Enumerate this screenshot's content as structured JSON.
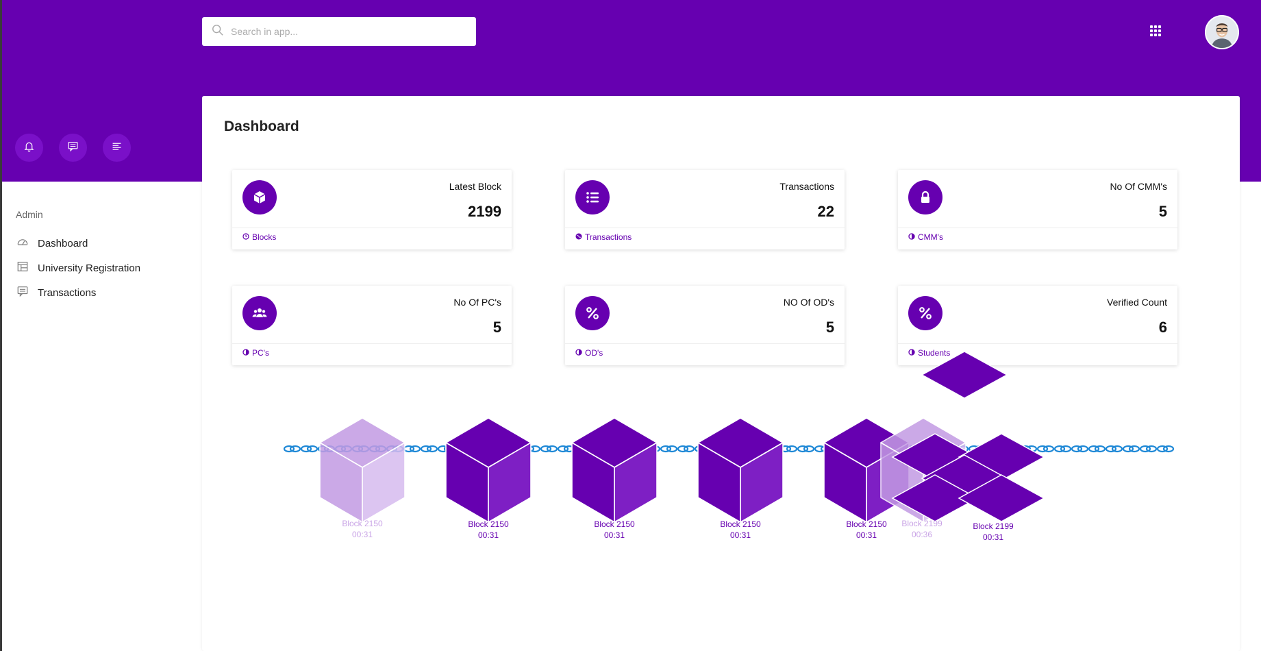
{
  "header": {
    "search_placeholder": "Search in app...",
    "apps_icon": "grid-icon",
    "avatar": "user-avatar"
  },
  "quick_actions": [
    {
      "icon": "bell-icon"
    },
    {
      "icon": "message-icon"
    },
    {
      "icon": "align-left-icon"
    }
  ],
  "sidebar": {
    "section_label": "Admin",
    "items": [
      {
        "label": "Dashboard",
        "icon": "dashboard-icon"
      },
      {
        "label": "University Registration",
        "icon": "table-icon"
      },
      {
        "label": "Transactions",
        "icon": "message-icon"
      }
    ]
  },
  "main": {
    "title": "Dashboard",
    "cards": [
      {
        "label": "Latest Block",
        "value": "2199",
        "footer": "Blocks",
        "icon": "cube-icon",
        "footer_icon": "clock-icon"
      },
      {
        "label": "Transactions",
        "value": "22",
        "footer": "Transactions",
        "icon": "list-icon",
        "footer_icon": "globe-icon"
      },
      {
        "label": "No Of CMM's",
        "value": "5",
        "footer": "CMM's",
        "icon": "lock-icon",
        "footer_icon": "half-circle-icon"
      },
      {
        "label": "No Of PC's",
        "value": "5",
        "footer": "PC's",
        "icon": "users-icon",
        "footer_icon": "half-circle-icon"
      },
      {
        "label": "NO Of OD's",
        "value": "5",
        "footer": "OD's",
        "icon": "percent-icon",
        "footer_icon": "half-circle-icon"
      },
      {
        "label": "Verified Count",
        "value": "6",
        "footer": "Students",
        "icon": "percent-icon",
        "footer_icon": "half-circle-icon"
      }
    ],
    "blocks": [
      {
        "name": "Block 2150",
        "time": "00:31",
        "faded": true
      },
      {
        "name": "Block 2150",
        "time": "00:31",
        "faded": false
      },
      {
        "name": "Block 2150",
        "time": "00:31",
        "faded": false
      },
      {
        "name": "Block 2150",
        "time": "00:31",
        "faded": false
      },
      {
        "name": "Block 2150",
        "time": "00:31",
        "faded": false
      },
      {
        "name": "Block 2199",
        "time": "00:36",
        "faded": true
      },
      {
        "name": "Block 2199",
        "time": "00:31",
        "faded": false
      }
    ]
  },
  "colors": {
    "brand": "#6600b0",
    "chain": "#1e88d6",
    "faded_block": "#c39be3"
  }
}
